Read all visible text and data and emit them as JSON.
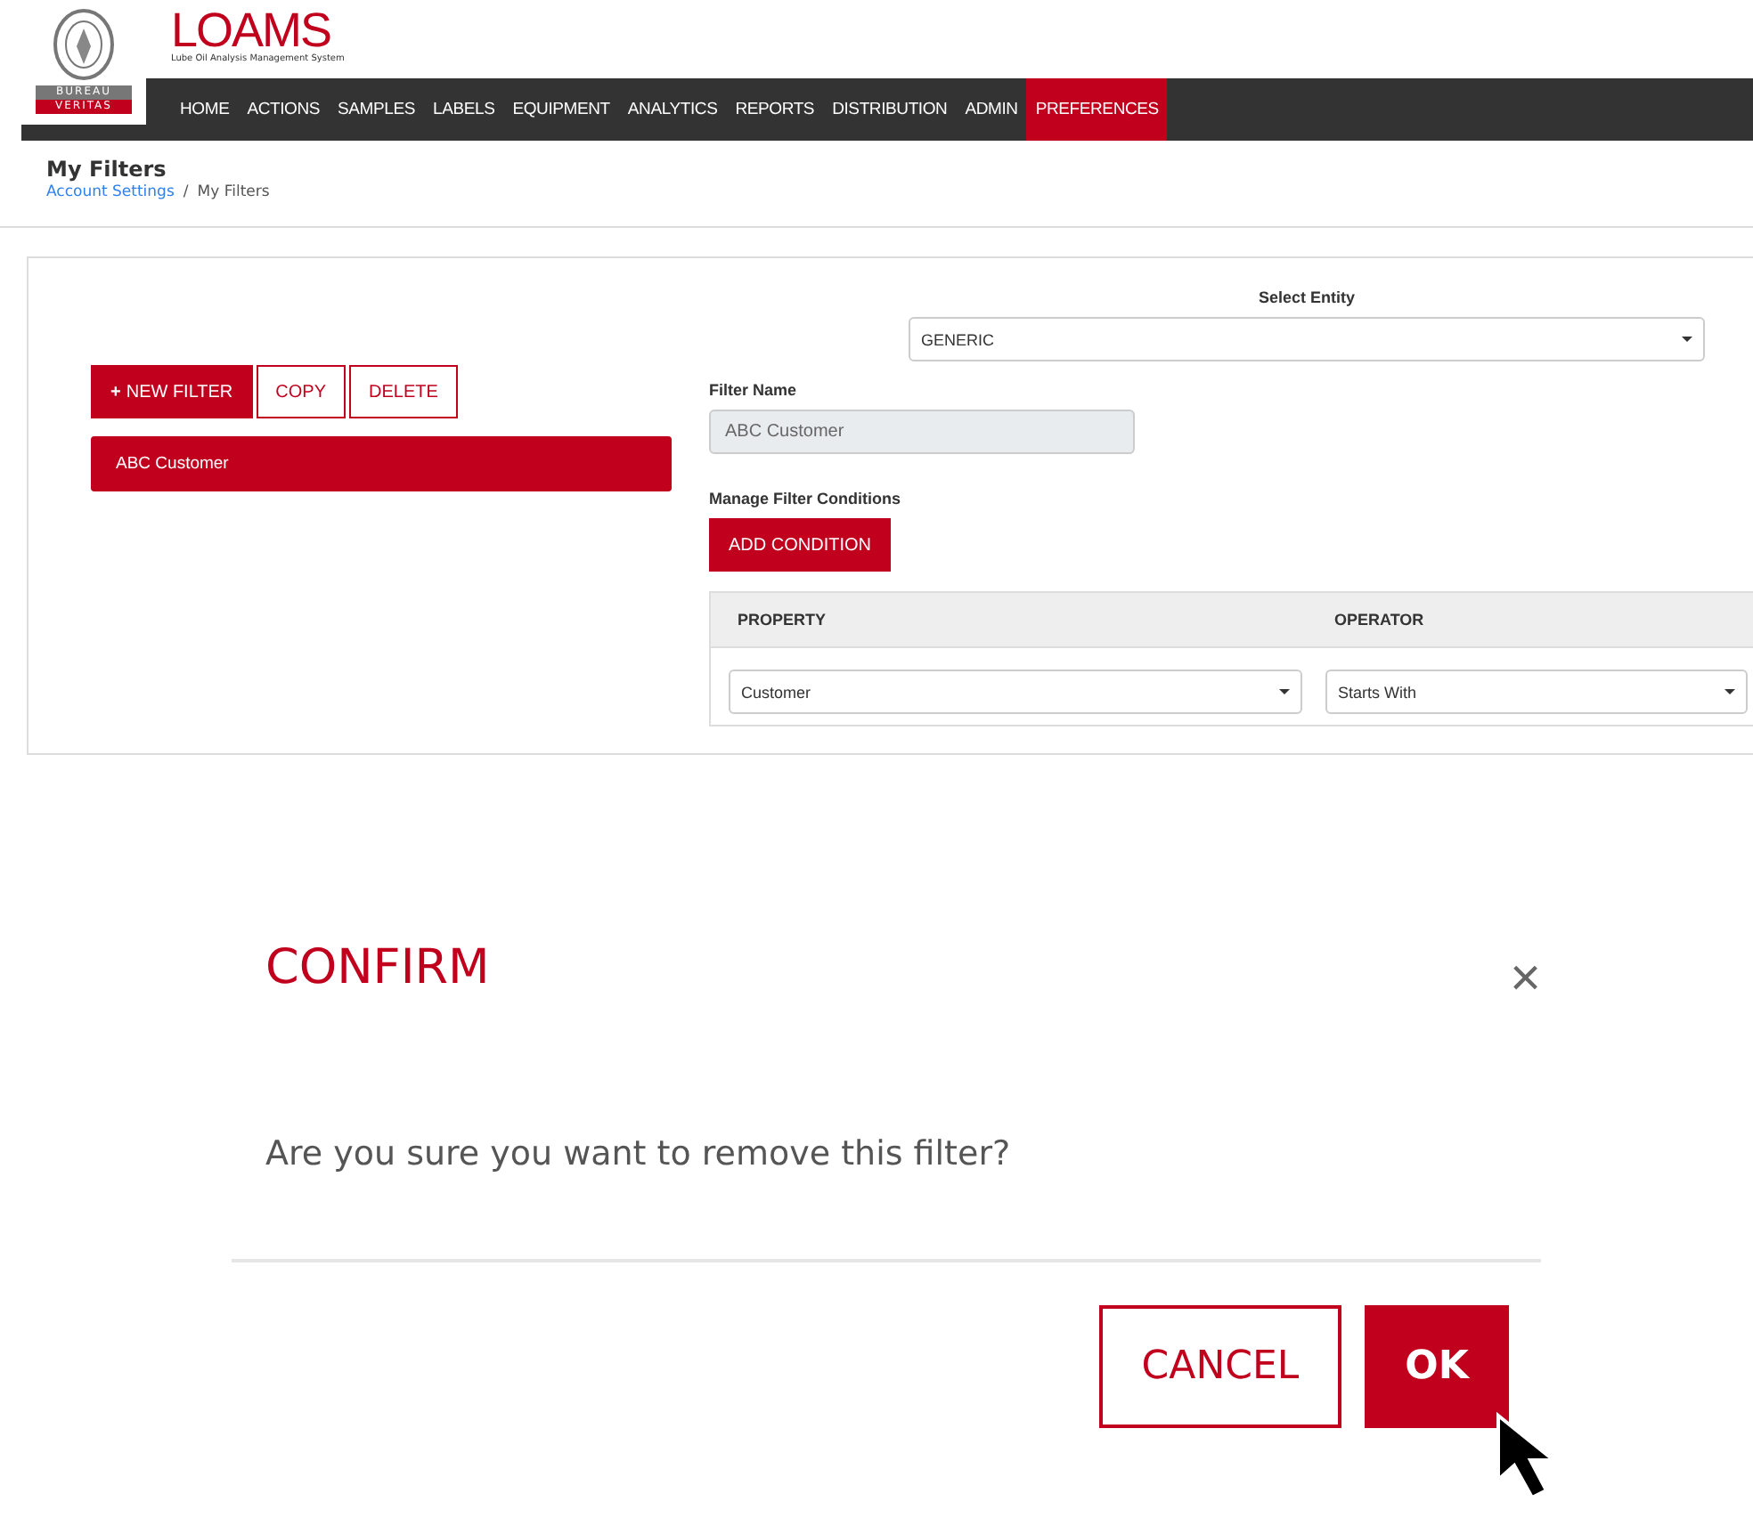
{
  "brand": {
    "name": "LOAMS",
    "tagline": "Lube Oil Analysis Management System",
    "badge_top": "BUREAU",
    "badge_bottom": "VERITAS"
  },
  "nav": [
    {
      "label": "HOME",
      "selected": false
    },
    {
      "label": "ACTIONS",
      "selected": false
    },
    {
      "label": "SAMPLES",
      "selected": false
    },
    {
      "label": "LABELS",
      "selected": false
    },
    {
      "label": "EQUIPMENT",
      "selected": false
    },
    {
      "label": "ANALYTICS",
      "selected": false
    },
    {
      "label": "REPORTS",
      "selected": false
    },
    {
      "label": "DISTRIBUTION",
      "selected": false
    },
    {
      "label": "ADMIN",
      "selected": false
    },
    {
      "label": "PREFERENCES",
      "selected": true
    }
  ],
  "page": {
    "title": "My Filters",
    "separator": "/",
    "breadcrumb": [
      {
        "label": "Account Settings",
        "kind": "link"
      },
      {
        "label": "My Filters",
        "kind": "current"
      }
    ]
  },
  "toolbar": {
    "new_filter": "NEW FILTER",
    "new_icon": "+",
    "copy": "COPY",
    "delete": "DELETE"
  },
  "filters": [
    {
      "label": "ABC Customer",
      "selected": true
    }
  ],
  "entity": {
    "label": "Select Entity",
    "value": "GENERIC"
  },
  "filter_name": {
    "label": "Filter Name",
    "value": "ABC Customer",
    "disabled": true
  },
  "conditions": {
    "label": "Manage Filter Conditions",
    "add_button": "ADD CONDITION",
    "columns": [
      "PROPERTY",
      "OPERATOR"
    ],
    "rows": [
      {
        "property": "Customer",
        "operator": "Starts With"
      }
    ]
  },
  "dialog": {
    "title": "CONFIRM",
    "close": "×",
    "message": "Are you sure you want to remove this filter?",
    "cancel": "CANCEL",
    "ok": "OK"
  }
}
